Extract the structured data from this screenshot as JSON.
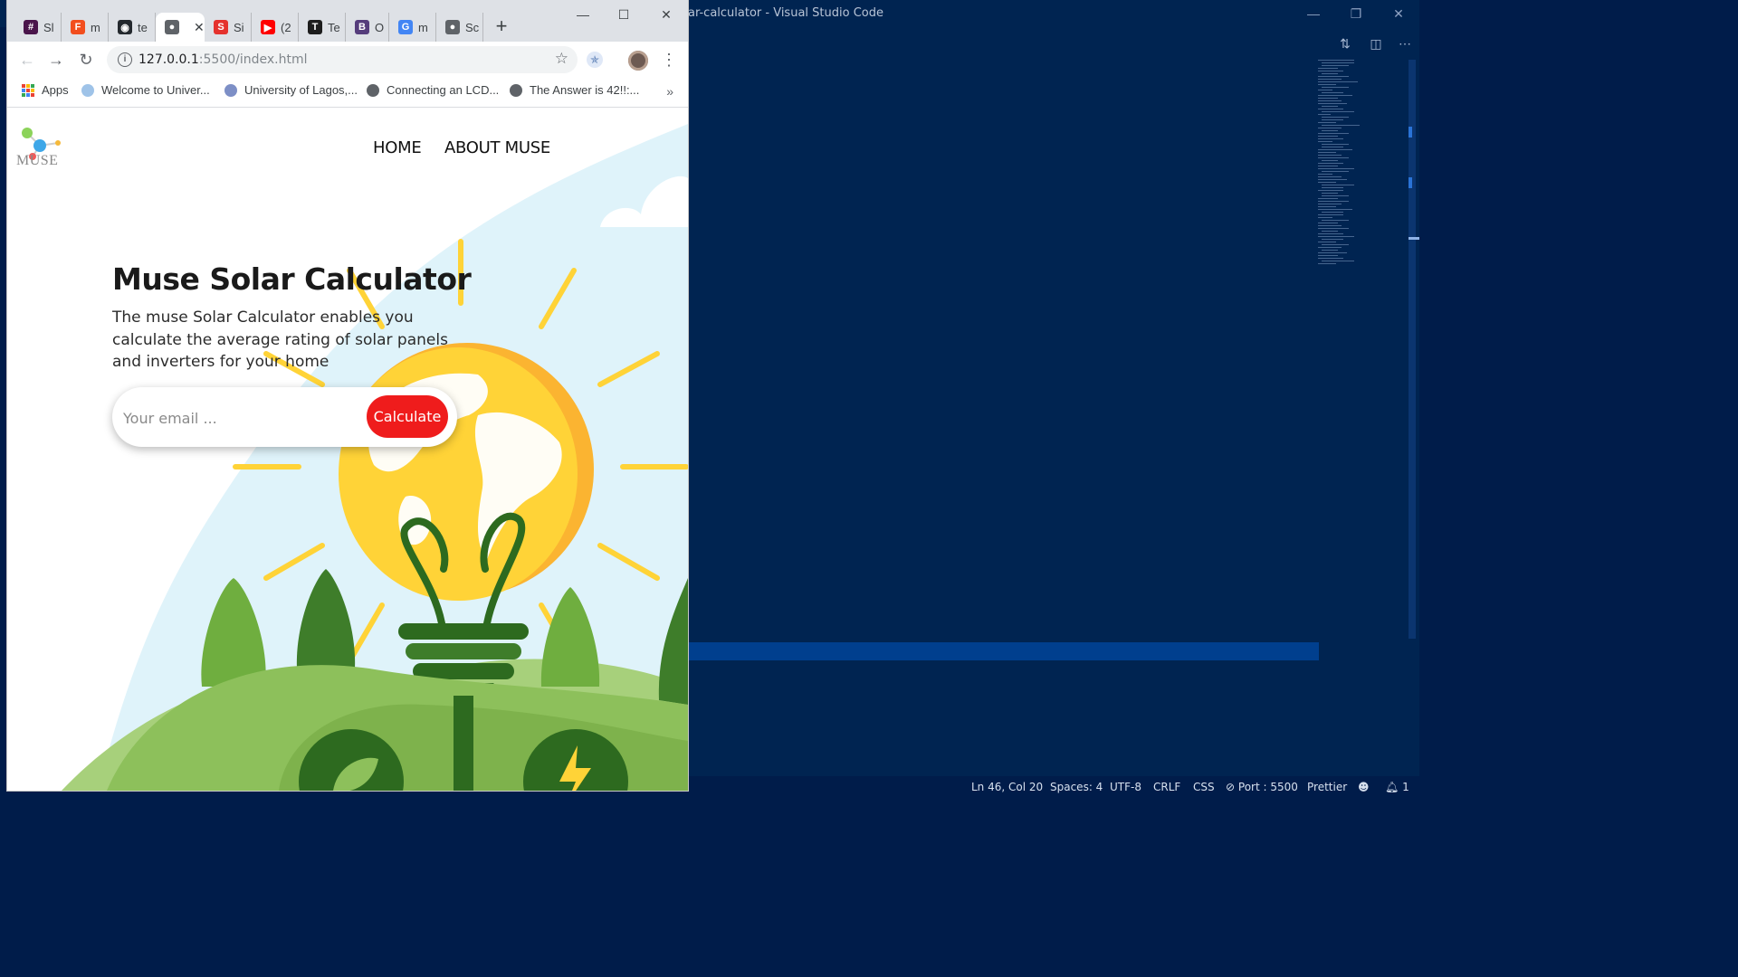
{
  "vscode": {
    "title": "ar-calculator - Visual Studio Code",
    "statusbar": {
      "position": "Ln 46, Col 20",
      "spaces": "Spaces: 4",
      "encoding": "UTF-8",
      "eol": "CRLF",
      "language": "CSS",
      "port": "Port : 5500",
      "formatter": "Prettier",
      "notifications": "1"
    }
  },
  "browser": {
    "tabs": [
      {
        "label": "Sl",
        "icon": "slack-icon",
        "color": "#4a154b"
      },
      {
        "label": "m",
        "icon": "figma-icon",
        "color": "#f24e1e"
      },
      {
        "label": "te",
        "icon": "github-icon",
        "color": "#24292e"
      },
      {
        "label": "",
        "icon": "globe-icon",
        "color": "#5f6368"
      },
      {
        "label": "Si",
        "icon": "s-brand-icon",
        "color": "#e5322d"
      },
      {
        "label": "(2",
        "icon": "youtube-icon",
        "color": "#ff0000"
      },
      {
        "label": "Te",
        "icon": "trello-icon",
        "color": "#1d1d1d"
      },
      {
        "label": "O",
        "icon": "b-brand-icon",
        "color": "#563d7c"
      },
      {
        "label": "m",
        "icon": "google-icon",
        "color": "#4285f4"
      },
      {
        "label": "Sc",
        "icon": "globe-icon",
        "color": "#5f6368"
      }
    ],
    "url_host": "127.0.0.1",
    "url_path": ":5500/index.html",
    "bookmarks": [
      {
        "label": "Apps"
      },
      {
        "label": "Welcome to Univer..."
      },
      {
        "label": "University of Lagos,..."
      },
      {
        "label": "Connecting an LCD..."
      },
      {
        "label": "The Answer is 42!!:..."
      }
    ],
    "more": "»"
  },
  "site": {
    "logo_text": "MUSE",
    "nav": [
      "HOME",
      "ABOUT MUSE"
    ],
    "hero_title": "Muse Solar Calculator",
    "hero_text": "The muse Solar Calculator enables you calculate the average rating of solar panels and inverters for your home",
    "email_placeholder": "Your email ...",
    "cta_label": "Calculate",
    "colors": {
      "cta": "#ef1c1c",
      "sky": "#dff3fa",
      "bulb": "#ffd337",
      "hill": "#8dc05b"
    }
  }
}
